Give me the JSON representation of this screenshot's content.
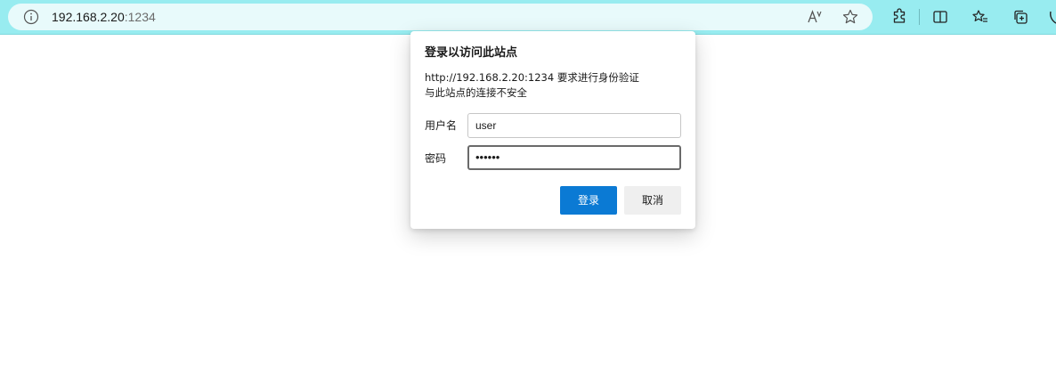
{
  "browser": {
    "address": {
      "host": "192.168.2.20",
      "port": ":1234"
    },
    "icons": [
      "info-icon",
      "read-aloud-icon",
      "favorite-icon",
      "extensions-icon",
      "split-screen-icon",
      "favorites-icon",
      "collections-icon",
      "browser-essentials-icon"
    ]
  },
  "dialog": {
    "title": "登录以访问此站点",
    "message_line1": "http://192.168.2.20:1234 要求进行身份验证",
    "message_line2": "与此站点的连接不安全",
    "username_label": "用户名",
    "username_value": "user",
    "password_label": "密码",
    "password_value": "••••••",
    "login_label": "登录",
    "cancel_label": "取消"
  },
  "colors": {
    "toolbar": "#98ecf0",
    "primary_button": "#0b7ad4"
  }
}
